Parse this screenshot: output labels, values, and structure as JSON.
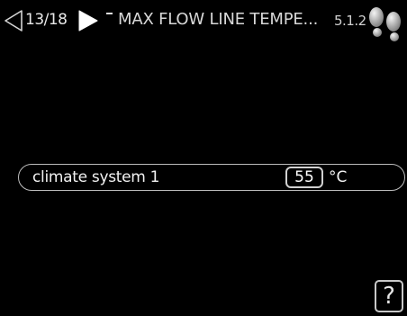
{
  "header": {
    "page_counter": "13/18",
    "title": "MAX FLOW LINE TEMPE...",
    "menu_number": "5.1.2",
    "icons": {
      "back": "triangle-left-outline-icon",
      "forward": "triangle-right-solid-icon",
      "level": "level-indicator-icon",
      "footprints": "footprints-icon"
    }
  },
  "setting": {
    "label": "climate system 1",
    "value": "55",
    "unit": "°C"
  },
  "help": {
    "label": "?",
    "icon": "help-icon"
  },
  "colors": {
    "background": "#000000",
    "text": "#ffffff",
    "border": "#bdbdbd"
  }
}
